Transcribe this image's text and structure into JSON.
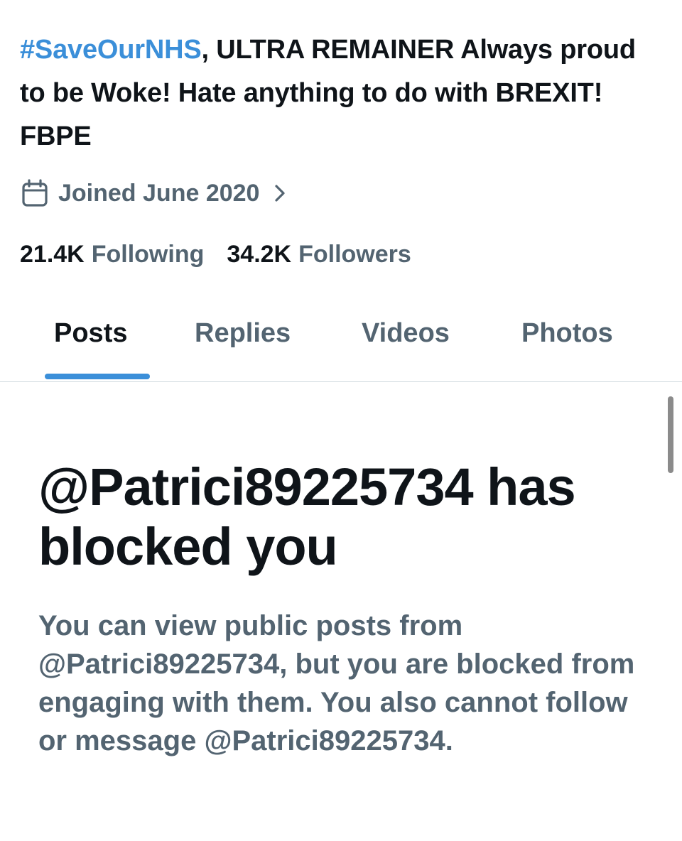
{
  "profile": {
    "bio_hashtag": "#SaveOurNHS",
    "bio_text": ", ULTRA REMAINER Always proud to be Woke! Hate anything to do with BREXIT! FBPE",
    "joined": "Joined June 2020",
    "following_count": "21.4K",
    "following_label": "Following",
    "followers_count": "34.2K",
    "followers_label": "Followers"
  },
  "tabs": [
    {
      "label": "Posts",
      "active": true
    },
    {
      "label": "Replies",
      "active": false
    },
    {
      "label": "Videos",
      "active": false
    },
    {
      "label": "Photos",
      "active": false
    }
  ],
  "blocked": {
    "title": "@Patrici89225734 has blocked you",
    "description": "You can view public posts from @Patrici89225734, but you are blocked from engaging with them. You also cannot follow or message @Patrici89225734."
  },
  "icons": {
    "calendar": "calendar-icon",
    "chevron": "chevron-right-icon"
  },
  "colors": {
    "accent": "#3b8fd9",
    "text_primary": "#0f1419",
    "text_secondary": "#536471"
  }
}
